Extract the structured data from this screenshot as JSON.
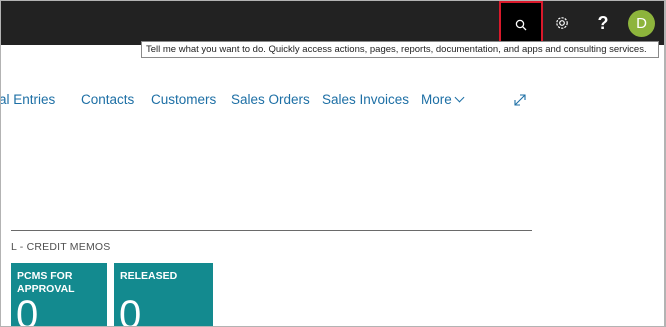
{
  "header": {
    "search_icon": "search-icon",
    "settings_icon": "gear-icon",
    "help_label": "?",
    "avatar_initial": "D",
    "avatar_color": "#8db43c",
    "highlight_color": "#d9192b"
  },
  "tooltip": {
    "text": "Tell me what you want to do. Quickly access actions, pages, reports, documentation, and apps and consulting services."
  },
  "nav": {
    "items": [
      "al Entries",
      "Contacts",
      "Customers",
      "Sales Orders",
      "Sales Invoices"
    ],
    "more_label": "More",
    "expand_icon": "expand-icon"
  },
  "section": {
    "title": "L - CREDIT MEMOS"
  },
  "tiles": [
    {
      "label_line1": "PCMS FOR",
      "label_line2": "APPROVAL",
      "value": "0"
    },
    {
      "label_line1": "RELEASED",
      "label_line2": "",
      "value": "0"
    }
  ],
  "colors": {
    "topbar": "#222222",
    "link": "#1d6fa5",
    "tile": "#138a8f"
  }
}
